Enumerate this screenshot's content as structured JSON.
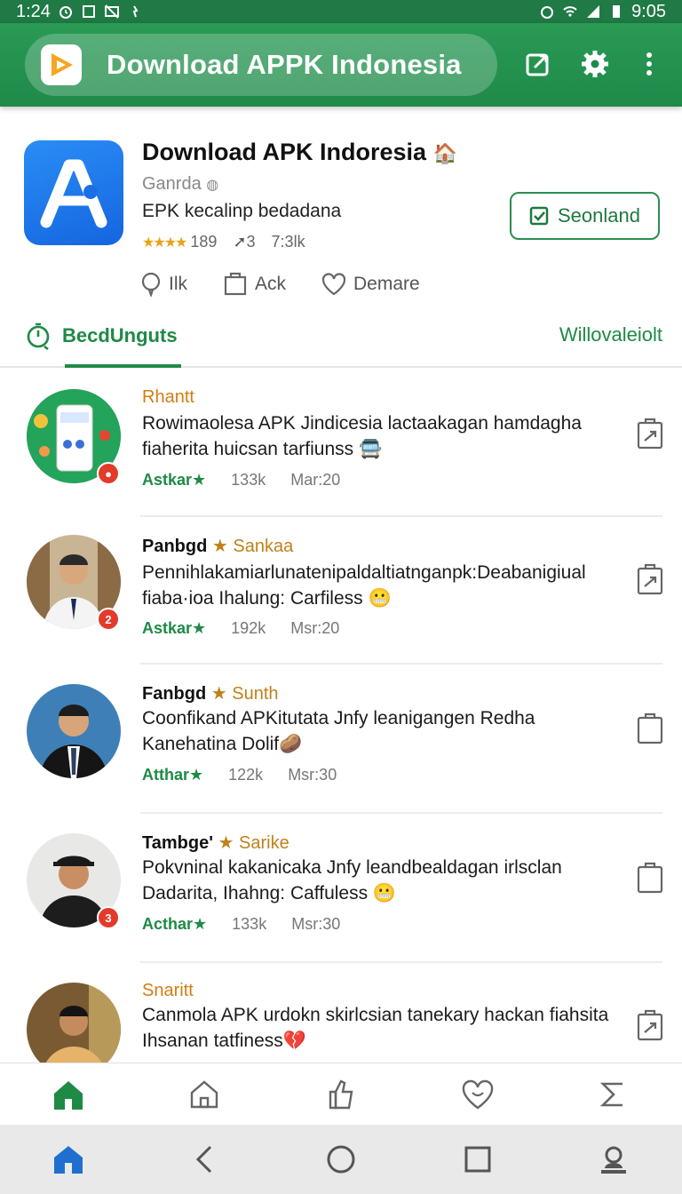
{
  "status_bar": {
    "time_left": "1:24",
    "time_right": "9:05"
  },
  "app_bar": {
    "title": "Download APPK Indonesia"
  },
  "app": {
    "name": "Download APK Indoresia",
    "name_emoji": "🏠",
    "developer": "Ganrda",
    "description": "EPK kecalinp bedadana",
    "rating_stars": "★★★★",
    "rating_count": "189",
    "shares": "3",
    "downloads": "7:3lk",
    "download_button": "Seonland",
    "actions": [
      {
        "label": "Ilk",
        "icon": "comment-icon"
      },
      {
        "label": "Ack",
        "icon": "clipboard-icon"
      },
      {
        "label": "Demare",
        "icon": "heart-icon"
      }
    ]
  },
  "tabs": {
    "active": "BecdUnguts",
    "right": "Willovaleiolt"
  },
  "feed": [
    {
      "author": "Rhantt",
      "author_style": "orange",
      "tag": "",
      "text": "Rowimaolesa APK Jindicesia lactaakagan hamdagha fiaherita huicsan tarfiunss 🚍",
      "label": "Astkar★",
      "count": "133k",
      "time": "Mar:20",
      "badge": "●",
      "icon": "share-edit-icon"
    },
    {
      "author": "Panbgd",
      "author_style": "dark",
      "tag": "★ Sankaa",
      "text": "Pennihlakamiarlunatenipaldaltiatnganpk:Deabanigiual fiaba·ioa Ihalung: Carfiless 😬",
      "label": "Astkar★",
      "count": "192k",
      "time": "Msr:20",
      "badge": "2",
      "icon": "share-edit-icon"
    },
    {
      "author": "Fanbgd",
      "author_style": "dark",
      "tag": "★ Sunth",
      "text": "Coonfikand APKitutata Jnfy leanigangen Redha Kanehatina Dolif🥔",
      "label": "Atthar★",
      "count": "122k",
      "time": "Msr:30",
      "badge": "",
      "icon": "clipboard-icon"
    },
    {
      "author": "Tambge'",
      "author_style": "dark",
      "tag": "★ Sarike",
      "text": "Pokvninal kakanicaka Jnfy leandbealdagan irlsclan Dadarita, Ihahng: Caffuless 😬",
      "label": "Acthar★",
      "count": "133k",
      "time": "Msr:30",
      "badge": "3",
      "icon": "clipboard-icon"
    },
    {
      "author": "Snaritt",
      "author_style": "orange",
      "tag": "",
      "text": "Canmola APK urdokn skirlcsian tanekary hackan fiahsita Ihsanan tatfiness💔",
      "label": "",
      "count": "",
      "time": "",
      "badge": "",
      "icon": "share-edit-icon"
    }
  ],
  "bottom_nav": [
    "home-icon",
    "house-icon",
    "thumb-icon",
    "heart-face-icon",
    "sigma-icon"
  ],
  "system_nav": [
    "home-icon",
    "back-icon",
    "circle-home-icon",
    "recents-icon",
    "profile-icon"
  ],
  "colors": {
    "primary": "#1f8a4a",
    "accent_orange": "#d47d12",
    "badge_red": "#e33a2a",
    "app_icon_blue": "#1e78f0"
  }
}
